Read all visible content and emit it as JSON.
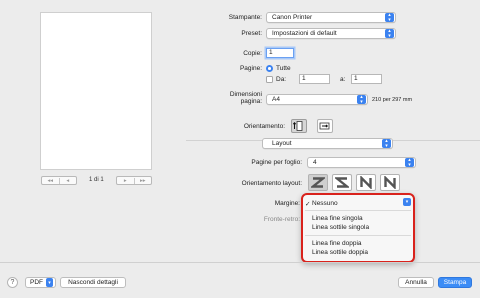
{
  "preview": {
    "pager_first": "◂◂",
    "pager_prev": "◂",
    "pager_next": "▸",
    "pager_last": "▸▸",
    "page_indicator": "1 di 1"
  },
  "printer": {
    "label": "Stampante:",
    "value": "Canon Printer"
  },
  "preset": {
    "label": "Preset:",
    "value": "Impostazioni di default"
  },
  "copies": {
    "label": "Copie:",
    "value": "1"
  },
  "pages": {
    "label": "Pagine:",
    "all_label": "Tutte",
    "from_label": "Da:",
    "from_value": "1",
    "to_label": "a:",
    "to_value": "1"
  },
  "paper_size": {
    "label_line1": "Dimensioni",
    "label_line2": "pagina:",
    "value": "A4",
    "dimensions": "210 per 297 mm"
  },
  "orientation": {
    "label": "Orientamento:"
  },
  "section": {
    "value": "Layout"
  },
  "pages_per_sheet": {
    "label": "Pagine per foglio:",
    "value": "4"
  },
  "layout_direction": {
    "label": "Orientamento layout:"
  },
  "border": {
    "label": "Margine:"
  },
  "two_sided": {
    "label": "Fronte-retro:"
  },
  "border_menu": {
    "items": [
      "Nessuno",
      "Linea fine singola",
      "Linea sottile singola",
      "Linea fine doppia",
      "Linea sottile doppia"
    ],
    "checkmark": "✓"
  },
  "bottom": {
    "help": "?",
    "pdf": "PDF",
    "hide_details": "Nascondi dettagli",
    "cancel": "Annulla",
    "print": "Stampa"
  },
  "colors": {
    "accent": "#3b82f0",
    "highlight_border": "#d9221c"
  }
}
